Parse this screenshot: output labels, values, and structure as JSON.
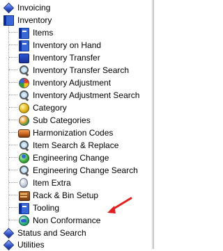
{
  "tree": {
    "invoicing": {
      "label": "Invoicing",
      "icon": "diamond-icon"
    },
    "inventory": {
      "label": "Inventory",
      "icon": "book-icon",
      "items": [
        {
          "label": "Items",
          "icon": "book-icon"
        },
        {
          "label": "Inventory on Hand",
          "icon": "book-icon"
        },
        {
          "label": "Inventory Transfer",
          "icon": "folder-icon"
        },
        {
          "label": "Inventory Transfer Search",
          "icon": "magnifier-icon"
        },
        {
          "label": "Inventory Adjustment",
          "icon": "color-wheel-icon"
        },
        {
          "label": "Inventory Adjustment Search",
          "icon": "magnifier-icon"
        },
        {
          "label": "Category",
          "icon": "sphere-icon"
        },
        {
          "label": "Sub Categories",
          "icon": "sphere-icon"
        },
        {
          "label": "Harmonization Codes",
          "icon": "capsule-icon"
        },
        {
          "label": "Item Search & Replace",
          "icon": "magnifier-icon"
        },
        {
          "label": "Engineering Change",
          "icon": "globe-icon"
        },
        {
          "label": "Engineering Change Search",
          "icon": "magnifier-icon"
        },
        {
          "label": "Item Extra",
          "icon": "pin-icon"
        },
        {
          "label": "Rack & Bin Setup",
          "icon": "rack-icon"
        },
        {
          "label": "Tooling",
          "icon": "book-icon"
        },
        {
          "label": "Non Conformance",
          "icon": "globe-icon"
        }
      ]
    },
    "status_and_search": {
      "label": "Status and Search",
      "icon": "diamond-icon"
    },
    "utilities": {
      "label": "Utilities",
      "icon": "diamond-icon"
    }
  },
  "colors": {
    "arrow": "#e02020",
    "text": "#000000",
    "background": "#ffffff"
  }
}
